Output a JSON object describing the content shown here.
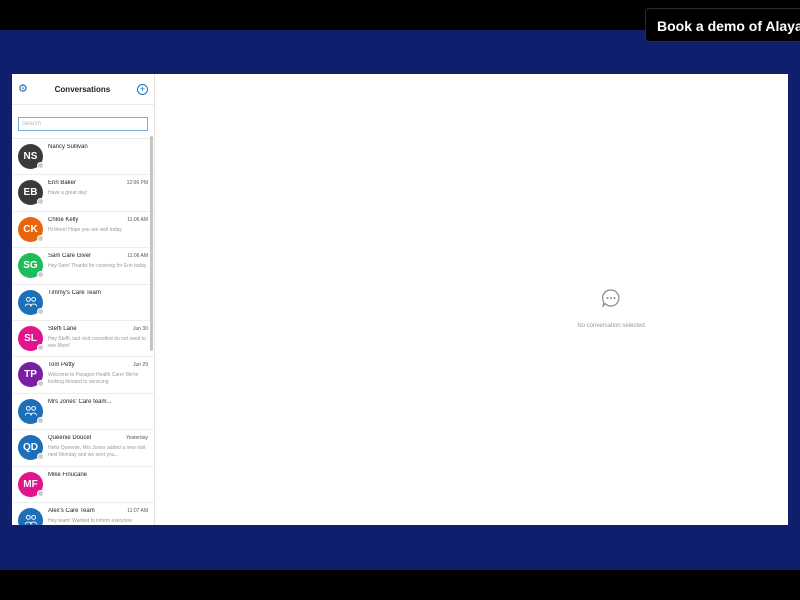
{
  "banner": {
    "cta_label": "Book a demo of AlayaCare"
  },
  "sidebar": {
    "title": "Conversations",
    "settings_icon": "gear-icon",
    "new_icon": "new-conversation-icon",
    "search_placeholder": "Search"
  },
  "conversations": [
    {
      "initials": "NS",
      "name": "Nancy Sullivan",
      "time": "",
      "message": "",
      "color": "#3a3a3a",
      "group": false
    },
    {
      "initials": "EB",
      "name": "Erin Baker",
      "time": "12:06 PM",
      "message": "Have a great day!",
      "color": "#3a3a3a",
      "group": false
    },
    {
      "initials": "CK",
      "name": "Chloe Kelly",
      "time": "11:06 AM",
      "message": "Hi there! Hope you are well today",
      "color": "#e8650e",
      "group": false
    },
    {
      "initials": "SG",
      "name": "Sam Care Giver",
      "time": "11:06 AM",
      "message": "Hey Sam! Thanks for covering for Erin today",
      "color": "#1ebc5a",
      "group": false
    },
    {
      "initials": "",
      "name": "Timmy's Care Team",
      "time": "",
      "message": "",
      "color": "#1d6fb8",
      "group": true
    },
    {
      "initials": "SL",
      "name": "Steffi Lane",
      "time": "Jun 30",
      "message": "Hey Steffi, last visit cancelled do not need to see Mom!",
      "color": "#e0148c",
      "group": false
    },
    {
      "initials": "TP",
      "name": "Tom Petty",
      "time": "Jun 29",
      "message": "Welcome to Paragon Health Care! We're looking forward to servicing",
      "color": "#7a1fa2",
      "group": false
    },
    {
      "initials": "",
      "name": "Mrs Jones' Care team...",
      "time": "",
      "message": "",
      "color": "#1d6fb8",
      "group": true
    },
    {
      "initials": "QD",
      "name": "Queenie Doucet",
      "time": "Yesterday",
      "message": "Hello Queenie, Mrs Jones added a new visit next Monday and we sent you...",
      "color": "#1d6fb8",
      "group": false
    },
    {
      "initials": "MF",
      "name": "Mike Finucane",
      "time": "",
      "message": "",
      "color": "#e0148c",
      "group": false
    },
    {
      "initials": "",
      "name": "Alex's Care Team",
      "time": "11:07 AM",
      "message": "Hey team! Wanted to inform everyone",
      "color": "#1d6fb8",
      "group": true
    }
  ],
  "main": {
    "empty_icon": "chat-bubble-icon",
    "empty_text": "No conversation selected"
  }
}
